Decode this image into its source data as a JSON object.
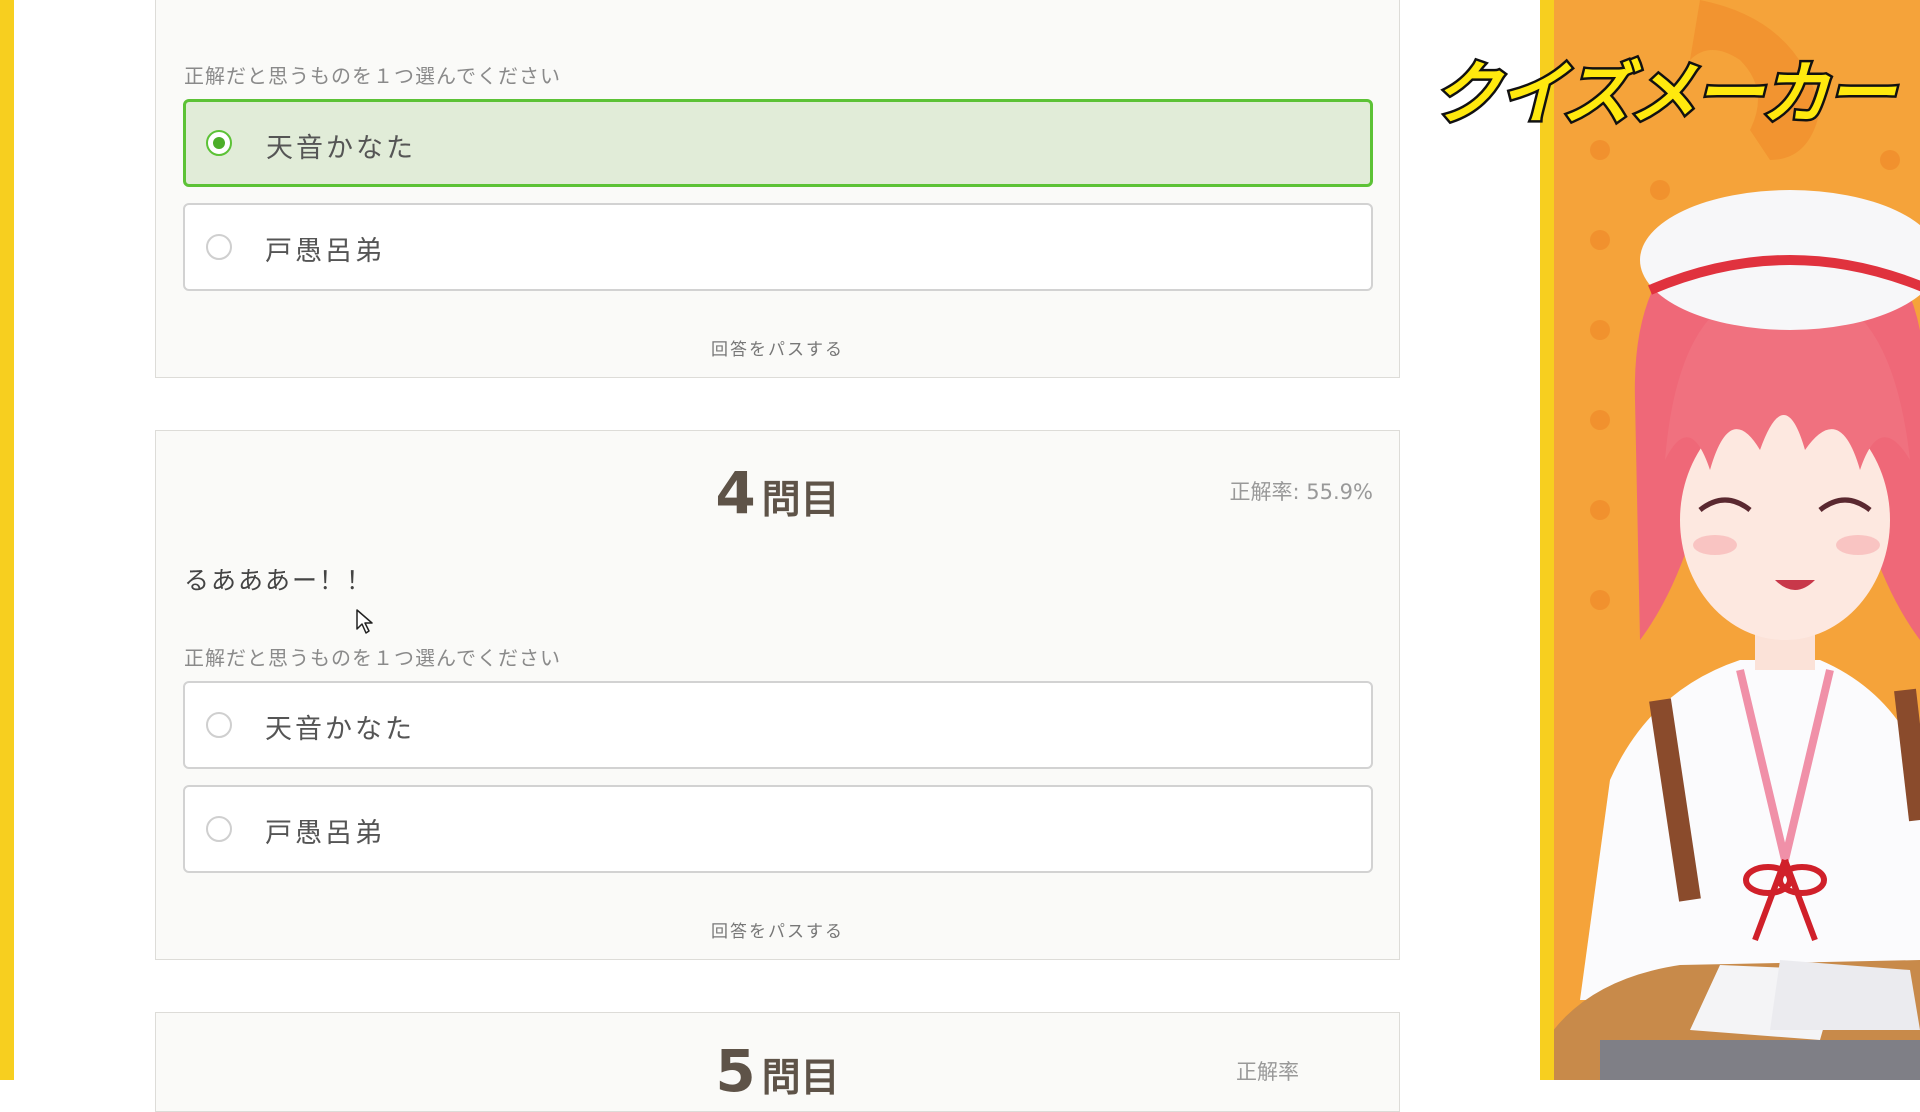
{
  "card_prev": {
    "instruction": "正解だと思うものを１つ選んでください",
    "options": [
      {
        "label": "天音かなた",
        "selected": true
      },
      {
        "label": "戸愚呂弟",
        "selected": false
      }
    ],
    "pass": "回答をパスする"
  },
  "card_q4": {
    "number": "4",
    "suffix": "問目",
    "rate": "正解率: 55.9%",
    "question": "るあああー！！",
    "instruction": "正解だと思うものを１つ選んでください",
    "options": [
      {
        "label": "天音かなた",
        "selected": false
      },
      {
        "label": "戸愚呂弟",
        "selected": false
      }
    ],
    "pass": "回答をパスする"
  },
  "card_q5": {
    "number": "5",
    "suffix": "問目",
    "rate": "正解率"
  },
  "overlay": {
    "banner": "クイズメーカー"
  },
  "colors": {
    "selected_border": "#5cc236",
    "selected_bg": "#e1ecd8",
    "accent_yellow": "#f7cf1f",
    "panel_orange": "#f5a33a"
  }
}
